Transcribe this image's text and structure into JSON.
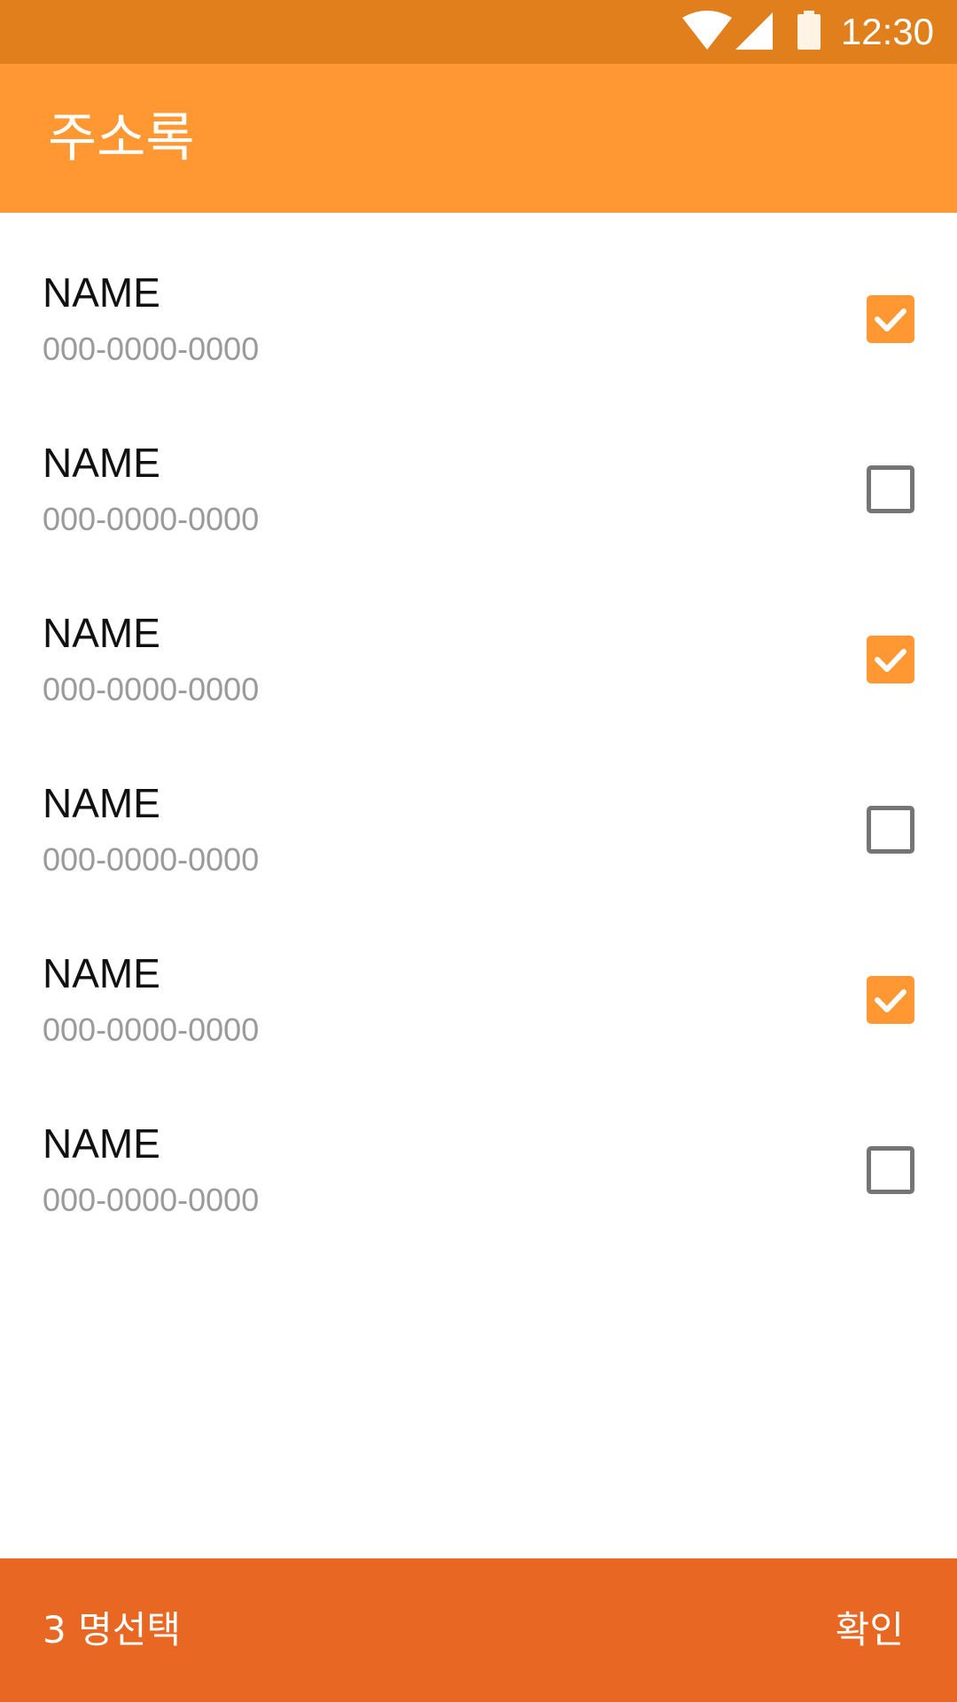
{
  "status_bar": {
    "time": "12:30",
    "icons": [
      "wifi-icon",
      "signal-icon",
      "battery-icon"
    ],
    "background_color": "#e07f1c"
  },
  "app_bar": {
    "title": "주소록",
    "background_color": "#ff9733"
  },
  "contacts": [
    {
      "name": "NAME",
      "phone": "000-0000-0000",
      "checked": true
    },
    {
      "name": "NAME",
      "phone": "000-0000-0000",
      "checked": false
    },
    {
      "name": "NAME",
      "phone": "000-0000-0000",
      "checked": true
    },
    {
      "name": "NAME",
      "phone": "000-0000-0000",
      "checked": false
    },
    {
      "name": "NAME",
      "phone": "000-0000-0000",
      "checked": true
    },
    {
      "name": "NAME",
      "phone": "000-0000-0000",
      "checked": false
    }
  ],
  "bottom_bar": {
    "selection_text": "3 명선택",
    "confirm_label": "확인",
    "background_color": "#e86722"
  },
  "colors": {
    "accent": "#ff9733",
    "checkbox_border": "#757575",
    "phone_text": "#9a9a9a"
  }
}
